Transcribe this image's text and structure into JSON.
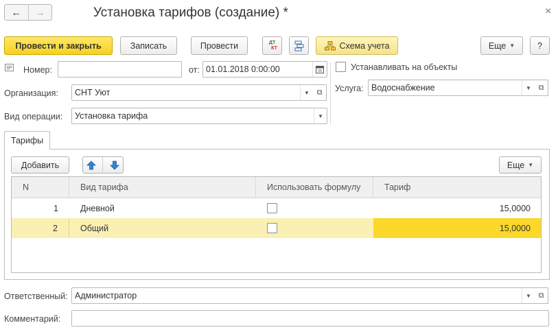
{
  "window": {
    "title": "Установка тарифов (создание) *",
    "nav_back": "←",
    "nav_forward": "→",
    "close": "×"
  },
  "toolbar": {
    "post_and_close": "Провести и закрыть",
    "save": "Записать",
    "post": "Провести",
    "dt_kt_top": "ДТ",
    "dt_kt_bottom": "КТ",
    "scheme": "Схема учета",
    "more": "Еще",
    "help": "?"
  },
  "form": {
    "number_label": "Номер:",
    "number_value": "",
    "date_label": "от:",
    "date_value": "01.01.2018  0:00:00",
    "set_on_objects_label": "Устанавливать на объекты",
    "set_on_objects_checked": false,
    "org_label": "Организация:",
    "org_value": "СНТ Уют",
    "service_label": "Услуга:",
    "service_value": "Водоснабжение",
    "op_type_label": "Вид операции:",
    "op_type_value": "Установка тарифа",
    "responsible_label": "Ответственный:",
    "responsible_value": "Администратор",
    "comment_label": "Комментарий:",
    "comment_value": ""
  },
  "tabs": [
    {
      "label": "Тарифы",
      "active": true
    }
  ],
  "table_toolbar": {
    "add": "Добавить",
    "more": "Еще"
  },
  "table": {
    "columns": [
      "N",
      "Вид тарифа",
      "Использовать формулу",
      "Тариф"
    ],
    "rows": [
      {
        "n": "1",
        "kind": "Дневной",
        "use_formula": false,
        "tariff": "15,0000",
        "selected": false
      },
      {
        "n": "2",
        "kind": "Общий",
        "use_formula": false,
        "tariff": "15,0000",
        "selected": true
      }
    ]
  },
  "colors": {
    "primary_button": "#f7d11e",
    "selected_row": "#fbf0b3",
    "selected_cell": "#fbd82a",
    "arrow_blue": "#2f86d6"
  },
  "icons": {
    "number_icon": "list-icon",
    "calendar": "calendar-icon",
    "open": "open-icon",
    "structure": "structure-icon",
    "scheme": "scheme-icon",
    "move_up": "arrow-up-icon",
    "move_down": "arrow-down-icon"
  }
}
